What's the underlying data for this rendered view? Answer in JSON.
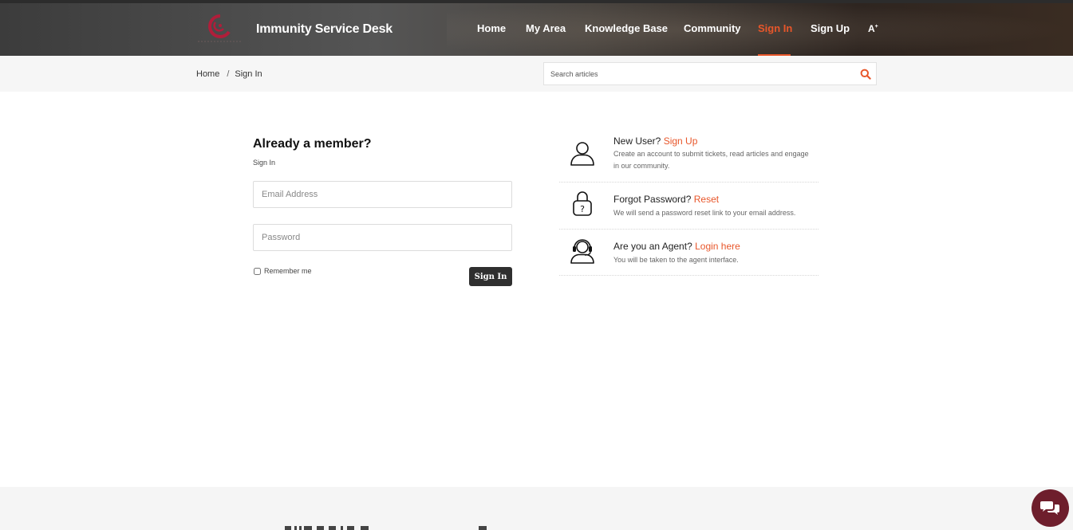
{
  "header": {
    "site_title": "Immunity Service Desk",
    "nav": [
      {
        "label": "Home"
      },
      {
        "label": "My Area"
      },
      {
        "label": "Knowledge Base"
      },
      {
        "label": "Community"
      },
      {
        "label": "Sign In",
        "active": true
      },
      {
        "label": "Sign Up"
      }
    ],
    "font_toggle": "A",
    "font_toggle_sup": "+",
    "accent_color": "#e8562a"
  },
  "breadcrumb": {
    "home": "Home",
    "separator": "/",
    "current": "Sign In"
  },
  "search": {
    "placeholder": "Search articles",
    "icon": "search-icon"
  },
  "login": {
    "title": "Already a member?",
    "subtitle": "Sign In",
    "email_placeholder": "Email Address",
    "password_placeholder": "Password",
    "remember_label": "Remember me",
    "submit_label": "Sign In"
  },
  "info": [
    {
      "icon": "user-icon",
      "question": "New User?",
      "link": "Sign Up",
      "desc": "Create an account to submit tickets, read articles and engage in our community."
    },
    {
      "icon": "lock-question-icon",
      "question": "Forgot Password?",
      "link": "Reset",
      "desc": "We will send a password reset link to your email address."
    },
    {
      "icon": "agent-headset-icon",
      "question": "Are you an Agent?",
      "link": "Login here",
      "desc": "You will be taken to the agent interface."
    }
  ],
  "chat": {
    "icon": "chat-bubbles-icon",
    "color": "#6e1e2c"
  }
}
